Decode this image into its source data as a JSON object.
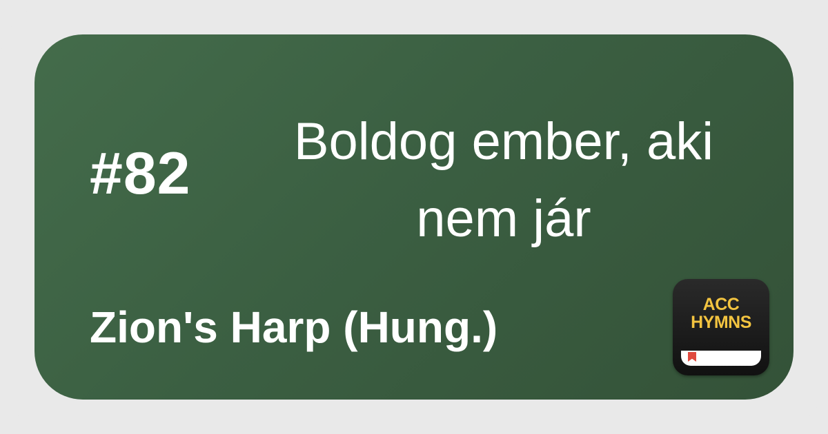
{
  "hymn": {
    "number": "#82",
    "title": "Boldog ember, aki\nnem jár",
    "book": "Zion's Harp (Hung.)"
  },
  "logo": {
    "line1": "ACC",
    "line2": "HYMNS",
    "name": "acc-hymns-logo"
  },
  "colors": {
    "background": "#e9e9e9",
    "card": "#3f6446",
    "text": "#ffffff",
    "logo_bg": "#1a1a1a",
    "logo_text": "#f3c440",
    "ribbon": "#e04a3f"
  }
}
